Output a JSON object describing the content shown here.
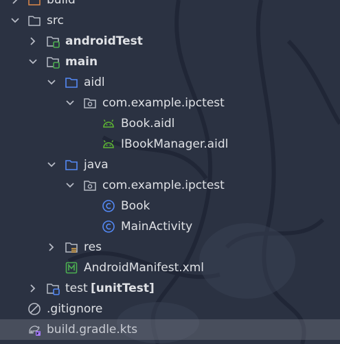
{
  "tree": {
    "build_label": "build",
    "src_label": "src",
    "android_test_label": "androidTest",
    "main_label": "main",
    "aidl_folder_label": "aidl",
    "aidl_package_label": "com.example.ipctest",
    "book_aidl_label": "Book.aidl",
    "ibookmanager_aidl_label": "IBookManager.aidl",
    "java_folder_label": "java",
    "java_package_label": "com.example.ipctest",
    "book_class_label": "Book",
    "main_activity_label": "MainActivity",
    "res_label": "res",
    "manifest_label": "AndroidManifest.xml",
    "test_label": "test",
    "test_suffix_label": "[unitTest]",
    "gitignore_label": ".gitignore",
    "build_gradle_label": "build.gradle.kts"
  },
  "colors": {
    "background": "#2b3242",
    "selection": "#585e6c",
    "folder_blue": "#548af7",
    "module_green": "#4caf50",
    "android_green": "#5fb832",
    "class_blue": "#548af7",
    "kotlin_purple": "#a97bff"
  }
}
